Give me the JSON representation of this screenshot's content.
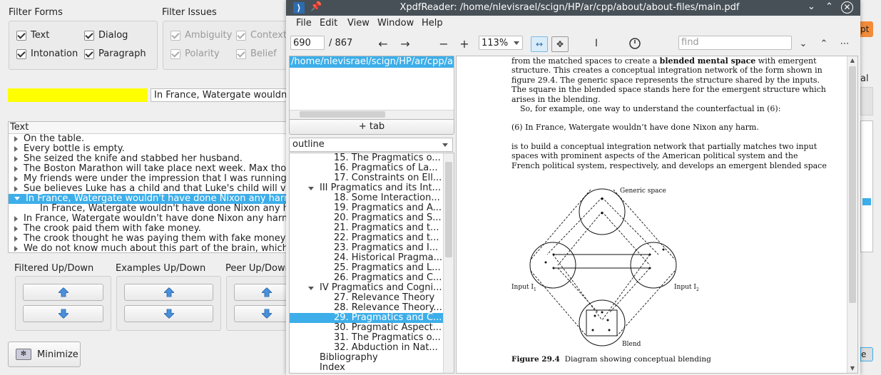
{
  "bg": {
    "filter_forms": {
      "title": "Filter Forms",
      "items": [
        {
          "label": "Text"
        },
        {
          "label": "Dialog"
        },
        {
          "label": "Intonation"
        },
        {
          "label": "Paragraph"
        }
      ]
    },
    "filter_issues": {
      "title": "Filter Issues",
      "items": [
        {
          "label": "Ambiguity"
        },
        {
          "label": "Context"
        },
        {
          "label": "Polarity"
        },
        {
          "label": "Belief"
        }
      ]
    },
    "search_value": "In France, Watergate wouldn't",
    "tree": {
      "header": "Text",
      "rows": [
        {
          "text": "On the table."
        },
        {
          "text": "Every bottle is empty."
        },
        {
          "text": "She seized the knife and stabbed her husband."
        },
        {
          "text": "The Boston Marathon will take place next week. Max thoug"
        },
        {
          "text": "My friends were under the impression that I was running a"
        },
        {
          "text": "Sue believes Luke has a child and that Luke's child will visit"
        },
        {
          "text": "In France, Watergate wouldn't have done Nixon any harm."
        },
        {
          "text": "In France, Watergate wouldn't have done Nixon any har"
        },
        {
          "text": "In France, Watergate wouldn't have done Nixon any harm b"
        },
        {
          "text": "The crook paid them with fake money."
        },
        {
          "text": "The crook thought he was paying them with fake money, b"
        },
        {
          "text": "We do not know much about this part of the brain, which p"
        }
      ]
    },
    "updown": [
      {
        "title": "Filtered Up/Down"
      },
      {
        "title": "Examples Up/Down"
      },
      {
        "title": "Peer Up/Down"
      }
    ],
    "minimize_label": "Minimize",
    "right_edge": {
      "label_al": "al",
      "label_pt": "pt",
      "label_e": "e"
    }
  },
  "xpdf": {
    "title": "XpdfReader: /home/nlevisrael/scign/HP/ar/cpp/about/about-files/main.pdf",
    "menu": [
      "File",
      "Edit",
      "View",
      "Window",
      "Help"
    ],
    "page_value": "690",
    "page_total": "/ 867",
    "zoom": "113%",
    "find_placeholder": "find",
    "tab_path": "/home/nlevisrael/scign/HP/ar/cpp/ab",
    "add_tab": "+ tab",
    "outline_select": "outline",
    "outline": [
      {
        "text": "15. The Pragmatics o..."
      },
      {
        "text": "16. Pragmatics of La..."
      },
      {
        "text": "17. Constraints on Ell..."
      },
      {
        "text": "III Pragmatics and its Int..."
      },
      {
        "text": "18. Some Interaction..."
      },
      {
        "text": "19. Pragmatics and A..."
      },
      {
        "text": "20. Pragmatics and S..."
      },
      {
        "text": "21. Pragmatics and t..."
      },
      {
        "text": "22. Pragmatics and t..."
      },
      {
        "text": "23. Pragmatics and I..."
      },
      {
        "text": "24. Historical Pragma..."
      },
      {
        "text": "25. Pragmatics and L..."
      },
      {
        "text": "26. Pragmatics and C..."
      },
      {
        "text": "IV Pragmatics and Cogni..."
      },
      {
        "text": "27. Relevance Theory"
      },
      {
        "text": "28. Relevance Theory..."
      },
      {
        "text": "29. Pragmatics and C..."
      },
      {
        "text": "30. Pragmatic Aspect..."
      },
      {
        "text": "31. The Pragmatics o..."
      },
      {
        "text": "32. Abduction in Nat..."
      },
      {
        "text": "Bibliography"
      },
      {
        "text": "Index"
      }
    ],
    "pdf": {
      "para1_a": "from the matched spaces to create a ",
      "para1_bold": "blended mental space",
      "para1_b": " with emergent",
      "para1_lines": [
        "structure. This creates a conceptual integration network of the form shown in",
        "figure 29.4. The generic space represents the structure shared by the inputs.",
        "The square in the blended space stands here for the emergent structure which",
        "arises in the blending."
      ],
      "para2": "So, for example, one way to understand the counterfactual in (6):",
      "example": "(6)   In France, Watergate wouldn’t have done Nixon any harm.",
      "para3_lines": [
        "is to build a conceptual integration network that partially matches two input",
        "spaces with prominent aspects of the American political system and the",
        "French political system, respectively, and develops an emergent blended space"
      ],
      "diagram": {
        "generic": "Generic space",
        "input1": "Input  I",
        "input1_sub": "1",
        "input2": "Input  I",
        "input2_sub": "2",
        "blend": "Blend"
      },
      "caption_label": "Figure 29.4",
      "caption_text": "Diagram showing conceptual blending"
    }
  }
}
